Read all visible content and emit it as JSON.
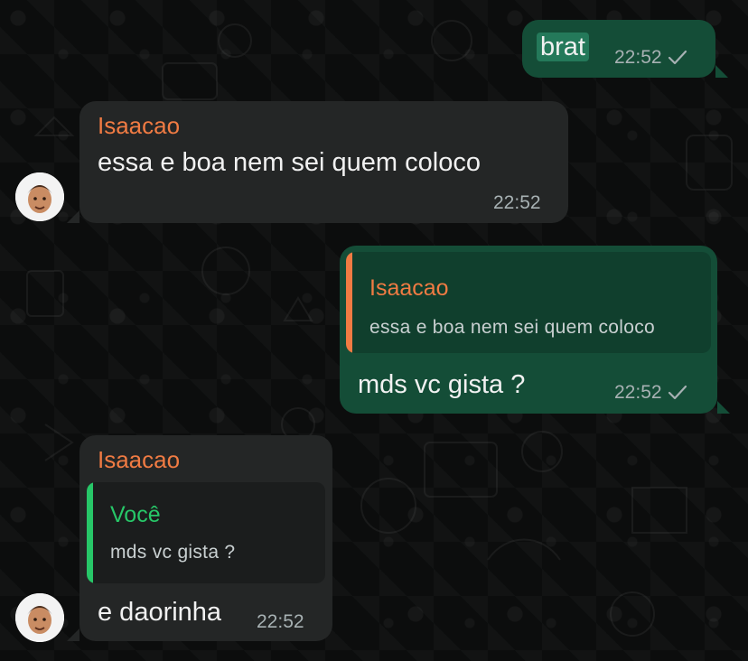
{
  "messages": [
    {
      "direction": "outgoing",
      "text": "brat",
      "time": "22:52",
      "status_icon": "check-icon"
    },
    {
      "direction": "incoming",
      "sender": "Isaacao",
      "text": "essa e boa nem sei quem coloco",
      "time": "22:52"
    },
    {
      "direction": "outgoing",
      "quote": {
        "author": "Isaacao",
        "text": "essa e boa nem sei quem coloco"
      },
      "text": "mds vc gista ?",
      "time": "22:52",
      "status_icon": "check-icon"
    },
    {
      "direction": "incoming",
      "sender": "Isaacao",
      "quote": {
        "author": "Você",
        "text": "mds vc gista ?"
      },
      "text": "e daorinha",
      "time": "22:52"
    }
  ],
  "colors": {
    "background": "#0c0d0d",
    "incoming_bubble": "#242626",
    "outgoing_bubble": "#144d37",
    "sender_name": "#f07b43",
    "self_quote_accent": "#27c768",
    "timestamp": "#a7b1b3"
  }
}
